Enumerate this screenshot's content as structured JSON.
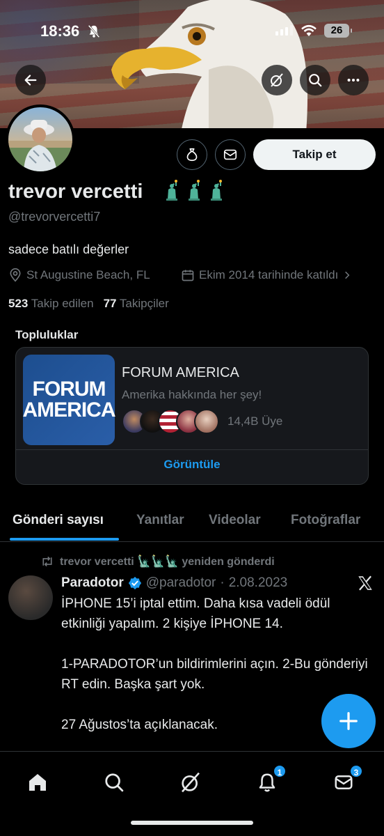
{
  "status": {
    "time": "18:36",
    "battery": "26"
  },
  "profile": {
    "display_name": "trevor vercetti",
    "emojis": "🗽🗽🗽",
    "handle": "@trevorvercetti7",
    "bio": "sadece batılı değerler",
    "location": "St Augustine Beach, FL",
    "joined": "Ekim 2014 tarihinde katıldı",
    "following_count": "523",
    "following_label": "Takip edilen",
    "followers_count": "77",
    "followers_label": "Takipçiler",
    "follow_button": "Takip et"
  },
  "communities": {
    "title": "Topluluklar",
    "logo_line1": "FORUM",
    "logo_line2": "AMERICA",
    "name": "FORUM AMERICA",
    "description": "Amerika hakkında her şey!",
    "members": "14,4B Üye",
    "view_label": "Görüntüle"
  },
  "tabs": [
    {
      "label": "Gönderi sayısı",
      "active": true
    },
    {
      "label": "Yanıtlar",
      "active": false
    },
    {
      "label": "Videolar",
      "active": false
    },
    {
      "label": "Fotoğraflar",
      "active": false
    }
  ],
  "tweet": {
    "repost_label": "trevor vercetti 🗽🗽🗽 yeniden gönderdi",
    "author_name": "Paradotor",
    "author_handle": "@paradotor",
    "separator": "·",
    "date": "2.08.2023",
    "text": "İPHONE 15’i iptal ettim. Daha kısa vadeli ödül etkinliği yapalım. 2 kişiye İPHONE 14.\n\n1-PARADOTOR’un bildirimlerini açın. 2-Bu gönderiyi RT edin. Başka şart yok.\n\n27 Ağustos’ta açıklanacak."
  },
  "nav": {
    "notifications_badge": "1",
    "messages_badge": "3"
  },
  "colors": {
    "accent": "#1d9bf0",
    "background": "#000000",
    "muted": "#71767b"
  }
}
